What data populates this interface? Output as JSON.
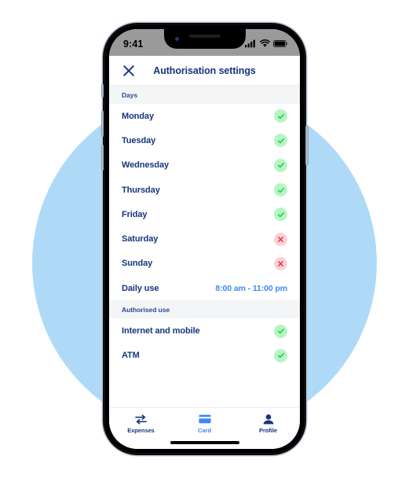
{
  "statusbar": {
    "time": "9:41",
    "icons": [
      "signal-icon",
      "wifi-icon",
      "battery-icon"
    ]
  },
  "header": {
    "close_icon": "close-icon",
    "title": "Authorisation settings"
  },
  "sections": [
    {
      "title": "Days",
      "rows": [
        {
          "label": "Monday",
          "state": "on",
          "icon": "check-icon"
        },
        {
          "label": "Tuesday",
          "state": "on",
          "icon": "check-icon"
        },
        {
          "label": "Wednesday",
          "state": "on",
          "icon": "check-icon"
        },
        {
          "label": "Thursday",
          "state": "on",
          "icon": "check-icon"
        },
        {
          "label": "Friday",
          "state": "on",
          "icon": "check-icon"
        },
        {
          "label": "Saturday",
          "state": "off",
          "icon": "cross-icon"
        },
        {
          "label": "Sunday",
          "state": "off",
          "icon": "cross-icon"
        },
        {
          "label": "Daily use",
          "state": "value",
          "value": "8:00 am - 11:00 pm"
        }
      ]
    },
    {
      "title": "Authorised use",
      "rows": [
        {
          "label": "Internet and mobile",
          "state": "on",
          "icon": "check-icon"
        },
        {
          "label": "ATM",
          "state": "on",
          "icon": "check-icon"
        },
        {
          "label": "",
          "state": "on",
          "icon": "check-icon"
        }
      ]
    }
  ],
  "tabbar": {
    "tabs": [
      {
        "label": "Expenses",
        "icon": "transfer-arrows-icon",
        "active": false
      },
      {
        "label": "Card",
        "icon": "credit-card-icon",
        "active": true
      },
      {
        "label": "Profile",
        "icon": "person-icon",
        "active": false
      }
    ]
  },
  "colors": {
    "background_circle": "#AEDAF8",
    "navy": "#16357e",
    "accent_blue": "#3d87f5",
    "green_fill": "#b6f5c2",
    "green_stroke": "#17c64a",
    "red_fill": "#fad2d8",
    "red_stroke": "#e8303a",
    "section_bg": "#f4f5f7"
  }
}
